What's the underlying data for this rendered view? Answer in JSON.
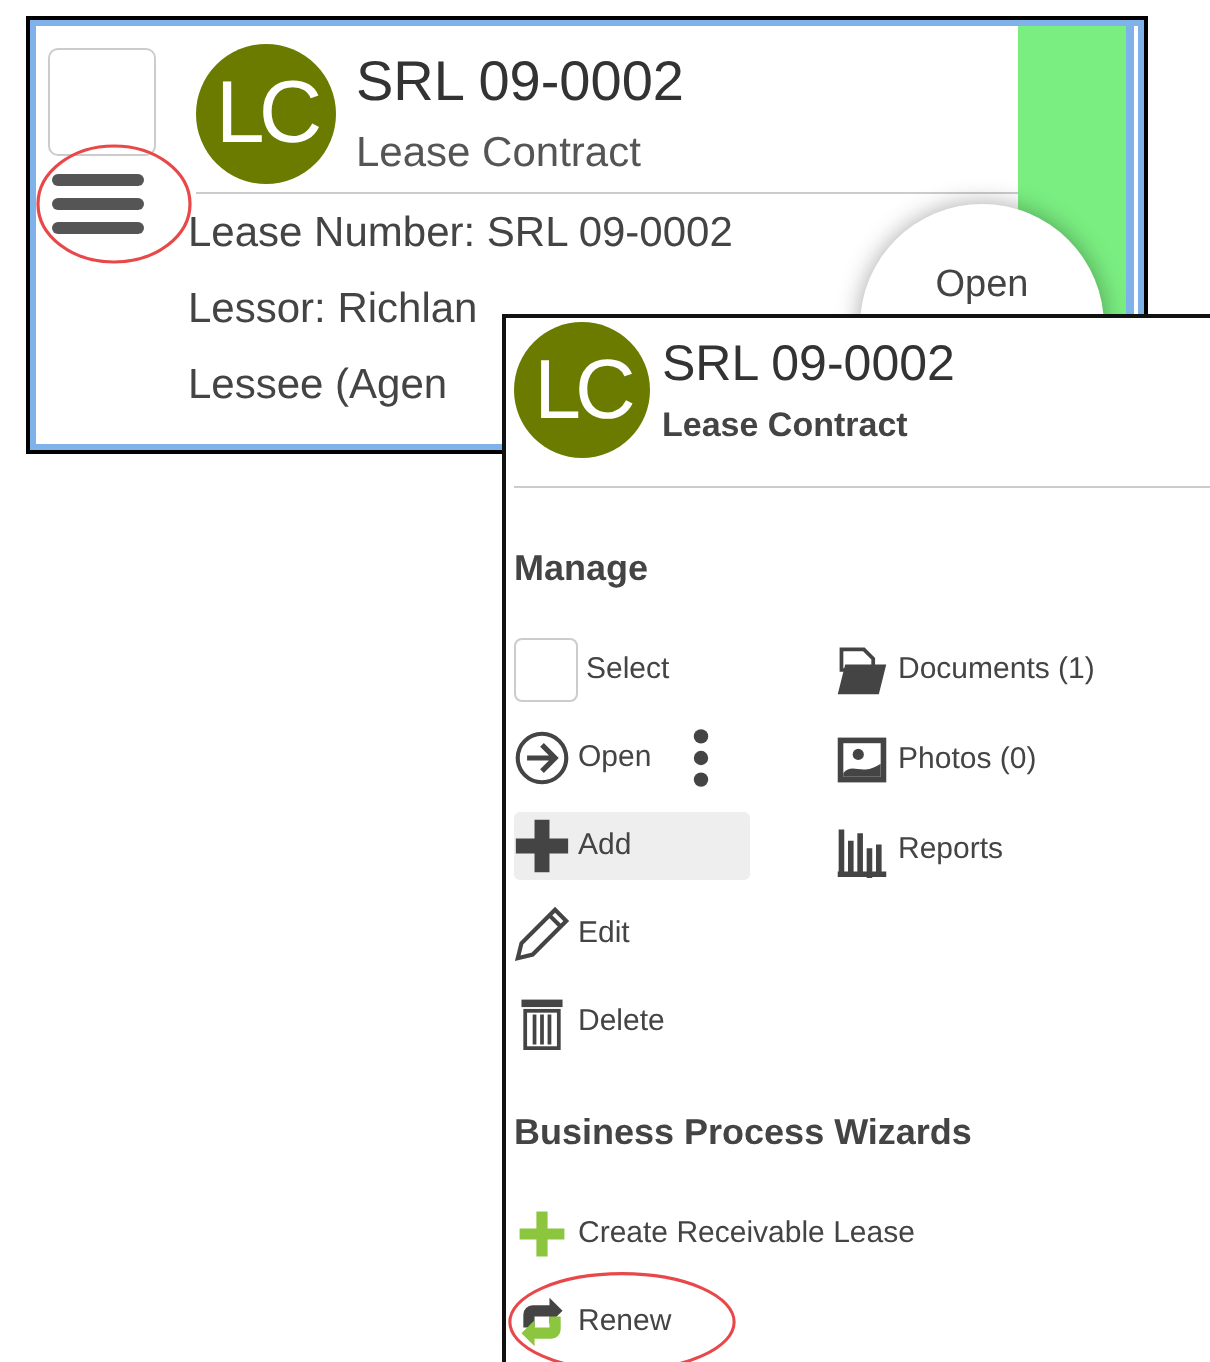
{
  "card": {
    "checked": false,
    "avatar": "LC",
    "title": "SRL 09-0002",
    "subtitle": "Lease Contract",
    "menu_highlighted": true,
    "lines": [
      "Lease Number: SRL 09-0002",
      "Lessor: Richlan",
      "Lessee (Agen"
    ],
    "open_button": "Open"
  },
  "popup": {
    "avatar": "LC",
    "title": "SRL 09-0002",
    "subtitle": "Lease Contract",
    "sections": [
      {
        "heading": "Manage",
        "columns": [
          [
            {
              "kind": "select",
              "label": "Select",
              "checked": false,
              "selected": false,
              "highlighted": false
            },
            {
              "kind": "open",
              "label": "Open",
              "selected": false,
              "highlighted": false
            },
            {
              "kind": "add",
              "label": "Add",
              "selected": true,
              "highlighted": false
            },
            {
              "kind": "edit",
              "label": "Edit",
              "selected": false,
              "highlighted": false
            },
            {
              "kind": "delete",
              "label": "Delete",
              "selected": false,
              "highlighted": false
            }
          ],
          [
            {
              "kind": "documents",
              "label": "Documents (1)",
              "selected": false,
              "highlighted": false
            },
            {
              "kind": "photos",
              "label": "Photos (0)",
              "selected": false,
              "highlighted": false
            },
            {
              "kind": "reports",
              "label": "Reports",
              "selected": false,
              "highlighted": false
            }
          ]
        ]
      },
      {
        "heading": "Business Process Wizards",
        "columns": [
          [
            {
              "kind": "create",
              "label": "Create Receivable Lease",
              "selected": false,
              "highlighted": false
            },
            {
              "kind": "renew",
              "label": "Renew",
              "selected": false,
              "highlighted": true
            }
          ]
        ]
      }
    ]
  }
}
